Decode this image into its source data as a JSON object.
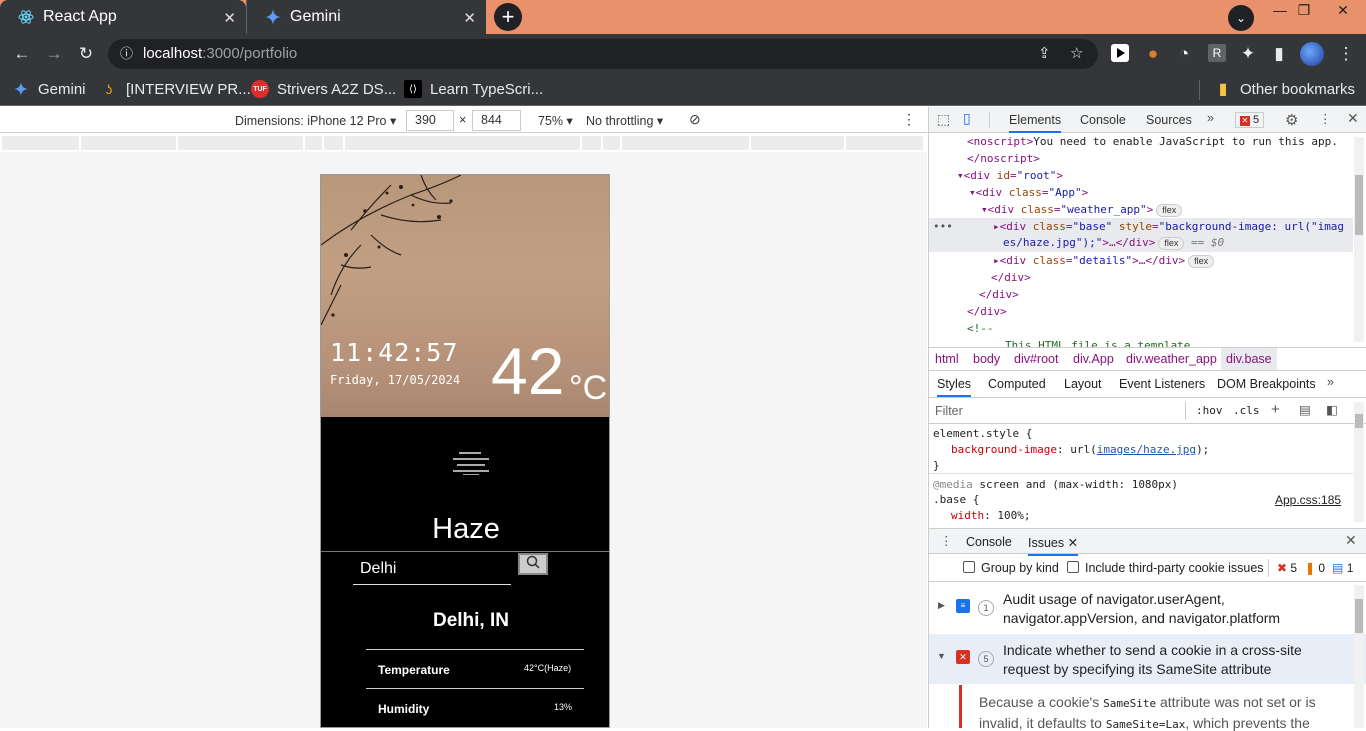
{
  "browser": {
    "tabs": [
      {
        "title": "React App",
        "icon": "react-icon"
      },
      {
        "title": "Gemini",
        "icon": "gemini-icon"
      }
    ],
    "url_host": "localhost",
    "url_rest": ":3000/portfolio",
    "bookmarks": [
      {
        "label": "Gemini",
        "icon": "gemini-icon"
      },
      {
        "label": "[INTERVIEW PR...",
        "icon": "leetcode-icon"
      },
      {
        "label": "Strivers A2Z DS...",
        "icon": "tuf-icon",
        "icon_text": "TUF"
      },
      {
        "label": "Learn TypeScri...",
        "icon": "typescript-icon"
      }
    ],
    "other_bookmarks": "Other bookmarks",
    "profile_letter": "R"
  },
  "device_toolbar": {
    "dimensions_label": "Dimensions: iPhone 12 Pro",
    "width": "390",
    "times": "×",
    "height": "844",
    "zoom": "75%",
    "throttle": "No throttling"
  },
  "app": {
    "time": "11:42:57",
    "date": "Friday, 17/05/2024",
    "temp": "42",
    "temp_unit": "°C",
    "condition": "Haze",
    "search_value": "Delhi",
    "location": "Delhi, IN",
    "rows": [
      {
        "label": "Temperature",
        "value": "42°C(Haze)"
      },
      {
        "label": "Humidity",
        "value": "13%"
      }
    ]
  },
  "devtools": {
    "tabs": [
      "Elements",
      "Console",
      "Sources"
    ],
    "error_count": "5",
    "dom_lines": {
      "l1_text": "You need to enable JavaScript to run this app.",
      "l1_open": "<noscript>",
      "l2": "</noscript>",
      "root_open": "<div ",
      "root_attr": "id",
      "root_val": "\"root\"",
      "app_attr": "class",
      "app_val": "\"App\"",
      "weather_val": "\"weather_app\"",
      "base_val": "\"base\"",
      "style_attr": "style",
      "style_val": "\"background-image: url(\"imag",
      "style_val2": "es/haze.jpg\");\"",
      "ellipsis_close": ">…</div>",
      "eq": "== $0",
      "details_val": "\"details\"",
      "close_div": "</div>",
      "comment_open": "<!--",
      "comment_text": "This HTML file is a template.",
      "flex": "flex",
      "dots": "•••"
    },
    "breadcrumbs": [
      "html",
      "body",
      "div#root",
      "div.App",
      "div.weather_app",
      "div.base"
    ],
    "style_tabs": [
      "Styles",
      "Computed",
      "Layout",
      "Event Listeners",
      "DOM Breakpoints"
    ],
    "filter_placeholder": "Filter",
    "hov": ":hov",
    "cls": ".cls",
    "css": {
      "element_style": "element.style {",
      "prop1": "background-image",
      "url_fn": "url(",
      "url_val": "images/haze.jpg",
      "url_end": ");",
      "close": "}",
      "media": "@media",
      "media_rest": " screen and (max-width: 1080px)",
      "selector": ".base {",
      "source": "App.css:185",
      "prop2": "width",
      "val2": "100%;"
    },
    "drawer_tabs": [
      "Console",
      "Issues"
    ],
    "group_by_kind": "Group by kind",
    "third_party": "Include third-party cookie issues",
    "counts": {
      "errors": "5",
      "warnings": "0",
      "info": "1"
    },
    "issues": [
      {
        "count": "1",
        "line1": "Audit usage of navigator.userAgent,",
        "line2": "navigator.appVersion, and navigator.platform"
      },
      {
        "count": "5",
        "line1": "Indicate whether to send a cookie in a cross-site",
        "line2": "request by specifying its SameSite attribute"
      }
    ],
    "issue_detail": {
      "p1": "Because a cookie's ",
      "code1": "SameSite",
      "p2": " attribute was not set or is",
      "p3": "invalid, it defaults to ",
      "code2": "SameSite=Lax",
      "p4": ", which prevents the"
    }
  }
}
